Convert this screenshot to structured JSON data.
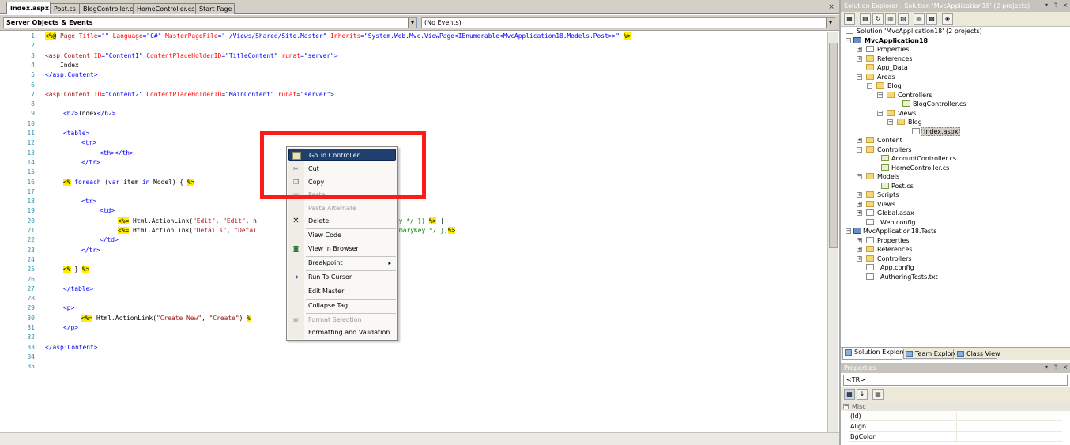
{
  "tabs": [
    "Index.aspx",
    "Post.cs",
    "BlogController.cs",
    "HomeController.cs",
    "Start Page"
  ],
  "tab_close": "×",
  "dropdowns": {
    "left": "Server Objects & Events",
    "right": "(No Events)"
  },
  "line_numbers": [
    "1",
    "2",
    "3",
    "4",
    "5",
    "6",
    "7",
    "8",
    "9",
    "10",
    "11",
    "12",
    "13",
    "14",
    "15",
    "16",
    "17",
    "18",
    "19",
    "20",
    "21",
    "22",
    "23",
    "24",
    "25",
    "26",
    "27",
    "28",
    "29",
    "30",
    "31",
    "32",
    "33",
    "34",
    "35"
  ],
  "code": {
    "l1_open": "<%@",
    "l1_page": " Page ",
    "l1_a1": "Title",
    "l1_eq1": "=",
    "l1_v1": "\"\"",
    "l1_a2": " Language",
    "l1_eq2": "=",
    "l1_v2": "\"C#\"",
    "l1_a3": " MasterPageFile",
    "l1_eq3": "=",
    "l1_v3": "\"~/Views/Shared/Site.Master\"",
    "l1_a4": " Inherits",
    "l1_eq4": "=",
    "l1_v4": "\"System.Web.Mvc.ViewPage<IEnumerable<MvcApplication18.Models.Post>>\"",
    "l1_close": "%>",
    "l3_tag": "<asp:Content",
    "l3_a1": " ID",
    "l3_v1": "=\"Content1\"",
    "l3_a2": " ContentPlaceHolderID",
    "l3_v2": "=\"TitleContent\"",
    "l3_a3": " runat",
    "l3_v3": "=\"server\"",
    "l3_end": ">",
    "l4": "    Index",
    "l5": "</asp:Content>",
    "l7_tag": "<asp:Content",
    "l7_a1": " ID",
    "l7_v1": "=\"Content2\"",
    "l7_a2": " ContentPlaceHolderID",
    "l7_v2": "=\"MainContent\"",
    "l7_a3": " runat",
    "l7_v3": "=\"server\"",
    "l7_end": ">",
    "l9_open": "<h2>",
    "l9_text": "Index",
    "l9_close": "</h2>",
    "l11": "<table>",
    "l12": "<tr>",
    "l13": "<th></th>",
    "l14": "</tr>",
    "l16_open": "<%",
    "l16_kw1": " foreach",
    "l16_mid": " (",
    "l16_kw2": "var",
    "l16_mid2": " item ",
    "l16_kw3": "in",
    "l16_end": " Model) { ",
    "l16_close": "%>",
    "l18": "<tr>",
    "l19": "<td>",
    "l20_open": "<%=",
    "l20_a": " Html",
    "l20_b": ".ActionLink(",
    "l20_s1": "\"Edit\"",
    "l20_c": ", ",
    "l20_s2": "\"Edit\"",
    "l20_d": ", n",
    "l20_tail": "ey */ })",
    "l20_close": "%>",
    "l20_pipe": " |",
    "l21_open": "<%=",
    "l21_a": " Html",
    "l21_b": ".ActionLink(",
    "l21_s1": "\"Details\"",
    "l21_c": ", ",
    "l21_s2": "\"Detai",
    "l21_tail": "maryKey */ })",
    "l21_close": "%>",
    "l22": "</td>",
    "l23": "</tr>",
    "l25_open": "<%",
    "l25_mid": " } ",
    "l25_close": "%>",
    "l27": "</table>",
    "l29": "<p>",
    "l30_open": "<%=",
    "l30_a": " Html",
    "l30_b": ".ActionLink(",
    "l30_s1": "\"Create New\"",
    "l30_c": ", ",
    "l30_s2": "\"Create\"",
    "l30_d": ")",
    "l30_close": "%",
    "l31": "</p>",
    "l33": "</asp:Content>"
  },
  "solution_explorer": {
    "title": "Solution Explorer - Solution 'MvcApplication18' (2 projects)",
    "pin": "▾",
    "autohide": "ᛘ",
    "close": "×",
    "items": [
      "Solution 'MvcApplication18' (2 projects)",
      "MvcApplication18",
      "Properties",
      "References",
      "App_Data",
      "Areas",
      "Blog",
      "Controllers",
      "BlogController.cs",
      "Views",
      "Blog",
      "Index.aspx",
      "Content",
      "Controllers",
      "AccountController.cs",
      "HomeController.cs",
      "Models",
      "Post.cs",
      "Scripts",
      "Views",
      "Global.asax",
      "Web.config",
      "MvcApplication18.Tests",
      "Properties",
      "References",
      "Controllers",
      "App.config",
      "AuthoringTests.txt"
    ],
    "tabs": [
      "Solution Explorer",
      "Team Explorer",
      "Class View"
    ]
  },
  "properties": {
    "title": "Properties",
    "object": "<TR>",
    "category": "Misc",
    "rows": [
      "(Id)",
      "Align",
      "BgColor"
    ]
  },
  "context_menu": {
    "items": [
      "Go To Controller",
      "Cut",
      "Copy",
      "Paste",
      "Paste Alternate",
      "Delete",
      "View Code",
      "View in Browser",
      "Breakpoint",
      "Run To Cursor",
      "Edit Master",
      "Collapse Tag",
      "Format Selection",
      "Formatting and Validation..."
    ],
    "submenu_arrow": "▸"
  },
  "colors": {
    "highlight_box": "#ff1a1a",
    "menu_selection": "#1f3f6f",
    "line_numbers": "#2b91af"
  }
}
